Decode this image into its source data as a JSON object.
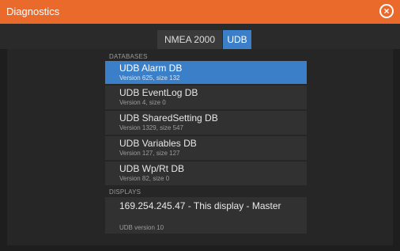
{
  "window": {
    "title": "Diagnostics"
  },
  "tabs": [
    {
      "label": "NMEA 2000"
    },
    {
      "label": "UDB"
    }
  ],
  "databases": {
    "header": "DATABASES",
    "items": [
      {
        "title": "UDB Alarm DB",
        "subtitle": "Version 625, size 132"
      },
      {
        "title": "UDB EventLog DB",
        "subtitle": "Version 4, size 0"
      },
      {
        "title": "UDB SharedSetting DB",
        "subtitle": "Version 1329, size 547"
      },
      {
        "title": "UDB Variables DB",
        "subtitle": "Version 127, size 127"
      },
      {
        "title": "UDB Wp/Rt DB",
        "subtitle": "Version 82, size 0"
      }
    ]
  },
  "displays": {
    "header": "DISPLAYS",
    "item": {
      "title": "169.254.245.47 - This display - Master",
      "subtitle": "UDB version 10"
    }
  },
  "colors": {
    "titlebar": "#ea6a2c",
    "selected": "#3a7fc8"
  }
}
